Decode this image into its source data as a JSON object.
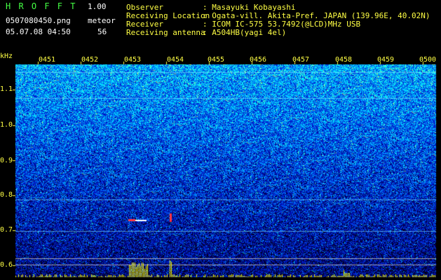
{
  "header": {
    "app_name": "H R O F F T",
    "version": "1.00",
    "filename": "0507080450.png",
    "datetime": "05.07.08 04:50",
    "counter_label": "meteor",
    "counter_value": "56"
  },
  "info": {
    "observer_label": "Observer",
    "observer_value": ": Masayuki Kobayashi",
    "location_label": "Receiving Location",
    "location_value": ": Ogata-vill. Akita-Pref. JAPAN (139.96E, 40.02N)",
    "receiver_label": "Receiver",
    "receiver_value": ": ICOM IC-575 53.7492(@LCD)MHz USB",
    "antenna_label": "Receiving antenna",
    "antenna_value": ": A504HB(yagi 4el)"
  },
  "axis": {
    "y_unit": "kHz",
    "y_ticks": [
      "1.1",
      "1.0",
      "0.9",
      "0.8",
      "0.7",
      "0.6"
    ],
    "y_values": [
      1.1,
      1.0,
      0.9,
      0.8,
      0.7,
      0.6
    ],
    "ylim": [
      0.58,
      1.16
    ],
    "x_ticks": [
      "0451",
      "0452",
      "0453",
      "0454",
      "0455",
      "0456",
      "0457",
      "0458",
      "0459",
      "0500"
    ]
  },
  "colors": {
    "label": "#ffff44",
    "value": "#44ff44",
    "background": "#000000"
  }
}
